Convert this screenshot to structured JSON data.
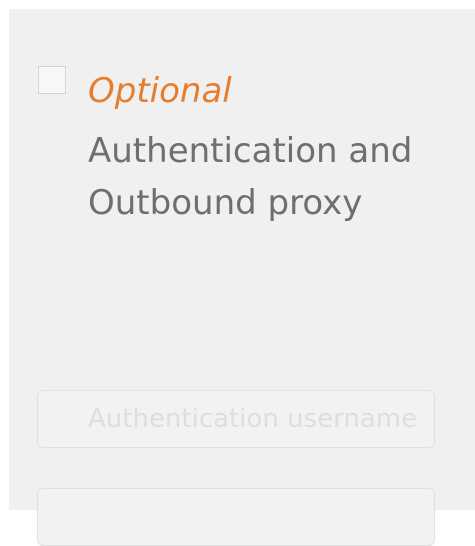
{
  "proxy_section": {
    "checkbox_checked": false,
    "optional_label": "Optional",
    "title_line1": "Authentication and",
    "title_line2": "Outbound proxy",
    "fields": [
      {
        "placeholder": "Authentication username"
      },
      {
        "placeholder": ""
      }
    ]
  }
}
